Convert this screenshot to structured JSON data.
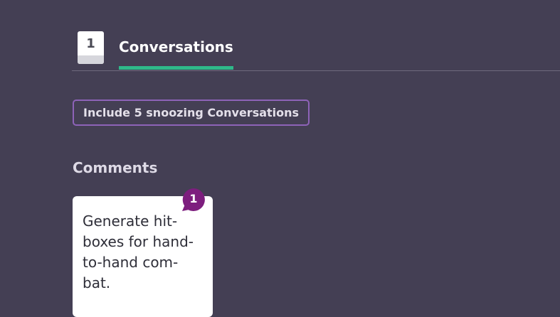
{
  "tabs": {
    "count": "1",
    "active_label": "Conversations"
  },
  "filters": {
    "snoozing_label": "Include 5 snoozing Conversations"
  },
  "comments": {
    "heading": "Comments",
    "cards": [
      {
        "text": "Generate hit-boxes for hand-to-hand com-bat.",
        "badge_count": "1"
      }
    ]
  },
  "colors": {
    "background": "#443f54",
    "accent_green": "#2fb98a",
    "chip_border": "#8e63b8",
    "badge": "#7d1e7e"
  },
  "icons": {
    "comment_badge": "speech-bubble-icon"
  }
}
